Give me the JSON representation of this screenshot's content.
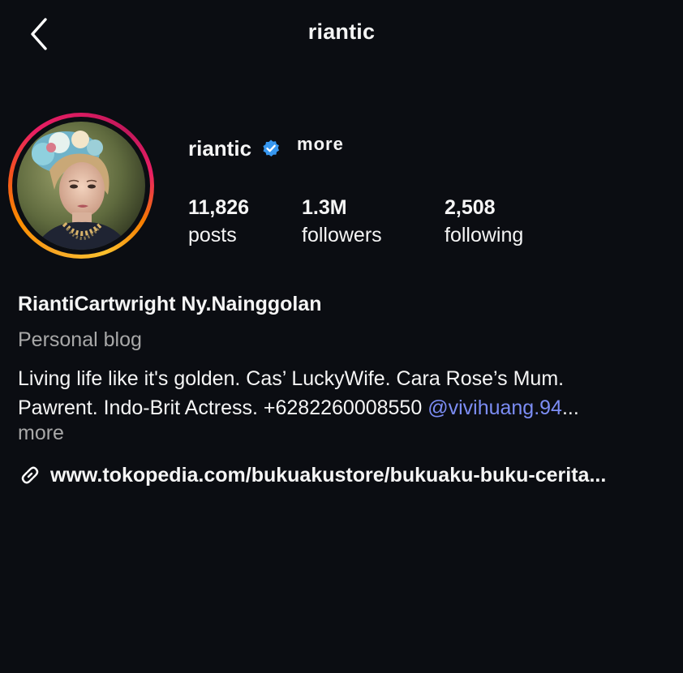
{
  "header": {
    "title": "riantic",
    "back_icon": "chevron-left-icon"
  },
  "profile": {
    "username": "riantic",
    "verified": true,
    "verified_color": "#3797f0",
    "more_label": "more",
    "stats": {
      "posts": {
        "value": "11,826",
        "label": "posts"
      },
      "followers": {
        "value": "1.3M",
        "label": "followers"
      },
      "following": {
        "value": "2,508",
        "label": "following"
      }
    },
    "full_name": "RiantiCartwright Ny.Nainggolan",
    "category": "Personal blog",
    "bio_line1": "Living life like it's golden. Cas’ LuckyWife. Cara Rose’s Mum.",
    "bio_line2_text": "Pawrent. Indo-Brit Actress. +6282260008550 ",
    "bio_mention": "@vivihuang.94",
    "bio_ellipsis": "...",
    "link": "www.tokopedia.com/bukuakustore/bukuaku-buku-cerita..."
  },
  "colors": {
    "background": "#0b0d12",
    "mention": "#7c8df4",
    "muted": "#a8a8a8"
  }
}
